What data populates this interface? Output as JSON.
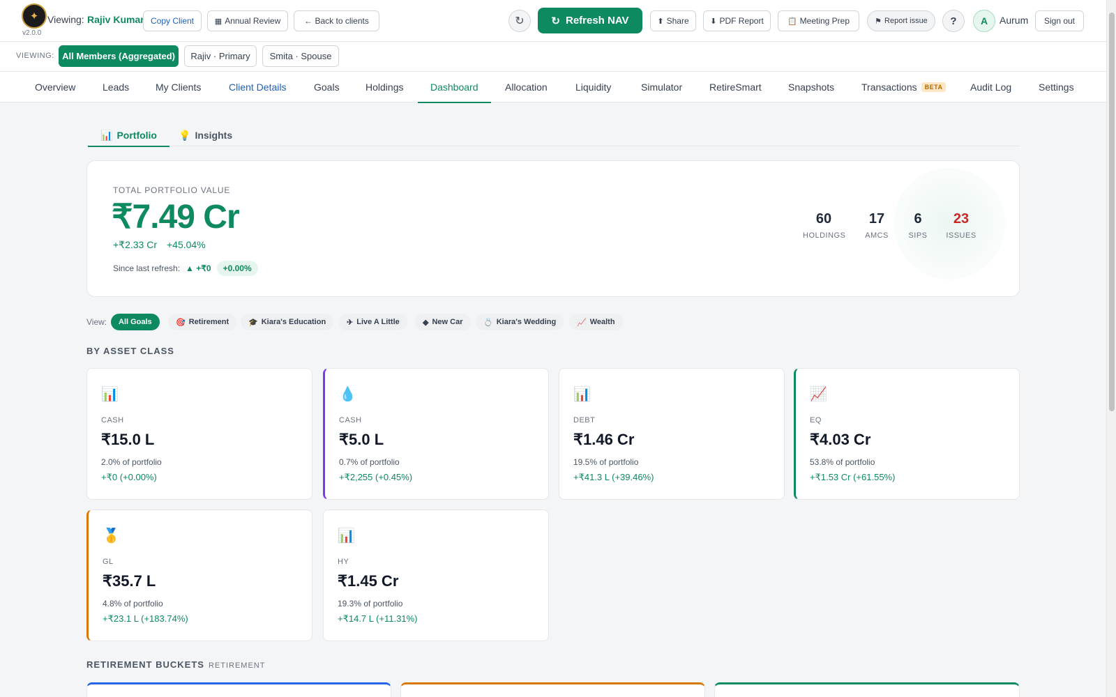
{
  "header": {
    "logo_glyph": "✦",
    "version": "v2.0.0",
    "viewing_label": "Viewing:",
    "client_name": "Rajiv Kumar",
    "copy_client": "Copy Client",
    "annual_review": "Annual Review",
    "back_to_clients": "← Back to clients",
    "refresh_glyph": "↻",
    "refresh_nav": "Refresh NAV",
    "share": "Share",
    "pdf_report": "PDF Report",
    "meeting_prep": "Meeting Prep",
    "report_issue": "Report issue",
    "help": "?",
    "avatar_initial": "A",
    "firm_name": "Aurum",
    "sign_out": "Sign out"
  },
  "members": {
    "label": "VIEWING:",
    "items": [
      "All Members (Aggregated)",
      "Rajiv · Primary",
      "Smita · Spouse"
    ],
    "active_index": 0
  },
  "nav": {
    "tabs": [
      "Overview",
      "Leads",
      "My Clients",
      "Client Details",
      "Goals",
      "Holdings",
      "Dashboard",
      "Allocation",
      "Liquidity",
      "Simulator",
      "RetireSmart",
      "Snapshots",
      "Transactions",
      "Audit Log",
      "Settings"
    ],
    "active": "Dashboard",
    "link_tab": "Client Details",
    "beta_badge": "BETA"
  },
  "subtabs": [
    {
      "label": "Portfolio",
      "icon": "bar-chart-icon",
      "glyph": "📊"
    },
    {
      "label": "Insights",
      "icon": "lightbulb-icon",
      "glyph": "💡"
    }
  ],
  "summary": {
    "label": "TOTAL PORTFOLIO VALUE",
    "value": "₹7.49 Cr",
    "gain_abs": "+₹2.33 Cr",
    "gain_pct": "+45.04%",
    "since_label": "Since last refresh:",
    "since_delta": "▲ +₹0",
    "since_pct": "+0.00%",
    "stats": [
      {
        "value": "60",
        "label": "HOLDINGS"
      },
      {
        "value": "17",
        "label": "AMCS"
      },
      {
        "value": "6",
        "label": "SIPS"
      },
      {
        "value": "23",
        "label": "ISSUES"
      }
    ]
  },
  "goal_filter": {
    "label": "View:",
    "chips": [
      {
        "label": "All Goals",
        "glyph": ""
      },
      {
        "label": "Retirement",
        "glyph": "🎯"
      },
      {
        "label": "Kiara's Education",
        "glyph": "🎓"
      },
      {
        "label": "Live A Little",
        "glyph": "✈"
      },
      {
        "label": "New Car",
        "glyph": "◆"
      },
      {
        "label": "Kiara's Wedding",
        "glyph": "💍"
      },
      {
        "label": "Wealth",
        "glyph": "📈"
      }
    ]
  },
  "asset_section_title": "BY ASSET CLASS",
  "asset_cards": [
    {
      "icon": "bar-chart-icon",
      "glyph": "📊",
      "type": "CASH",
      "value": "₹15.0 L",
      "pct": "2.0% of portfolio",
      "gain": "+₹0 (+0.00%)",
      "accent": ""
    },
    {
      "icon": "droplet-icon",
      "glyph": "💧",
      "type": "CASH",
      "value": "₹5.0 L",
      "pct": "0.7% of portfolio",
      "gain": "+₹2,255 (+0.45%)",
      "accent": "#7c3aed"
    },
    {
      "icon": "bar-chart-icon",
      "glyph": "📊",
      "type": "DEBT",
      "value": "₹1.46 Cr",
      "pct": "19.5% of portfolio",
      "gain": "+₹41.3 L (+39.46%)",
      "accent": ""
    },
    {
      "icon": "trend-chart-icon",
      "glyph": "📈",
      "type": "EQ",
      "value": "₹4.03 Cr",
      "pct": "53.8% of portfolio",
      "gain": "+₹1.53 Cr (+61.55%)",
      "accent": "#0d8a5f"
    },
    {
      "icon": "medal-icon",
      "glyph": "🥇",
      "type": "GL",
      "value": "₹35.7 L",
      "pct": "4.8% of portfolio",
      "gain": "+₹23.1 L (+183.74%)",
      "accent": "#d97706"
    },
    {
      "icon": "bar-chart-icon",
      "glyph": "📊",
      "type": "HY",
      "value": "₹1.45 Cr",
      "pct": "19.3% of portfolio",
      "gain": "+₹14.7 L (+11.31%)",
      "accent": ""
    }
  ],
  "retirement": {
    "title": "RETIREMENT BUCKETS",
    "subtitle": "RETIREMENT",
    "bucket_accents": [
      "#2563eb",
      "#d97706",
      "#0d8a5f"
    ]
  },
  "colors": {
    "brand": "#0d8a5f",
    "link": "#1d5fbf",
    "alert": "#c62828"
  }
}
